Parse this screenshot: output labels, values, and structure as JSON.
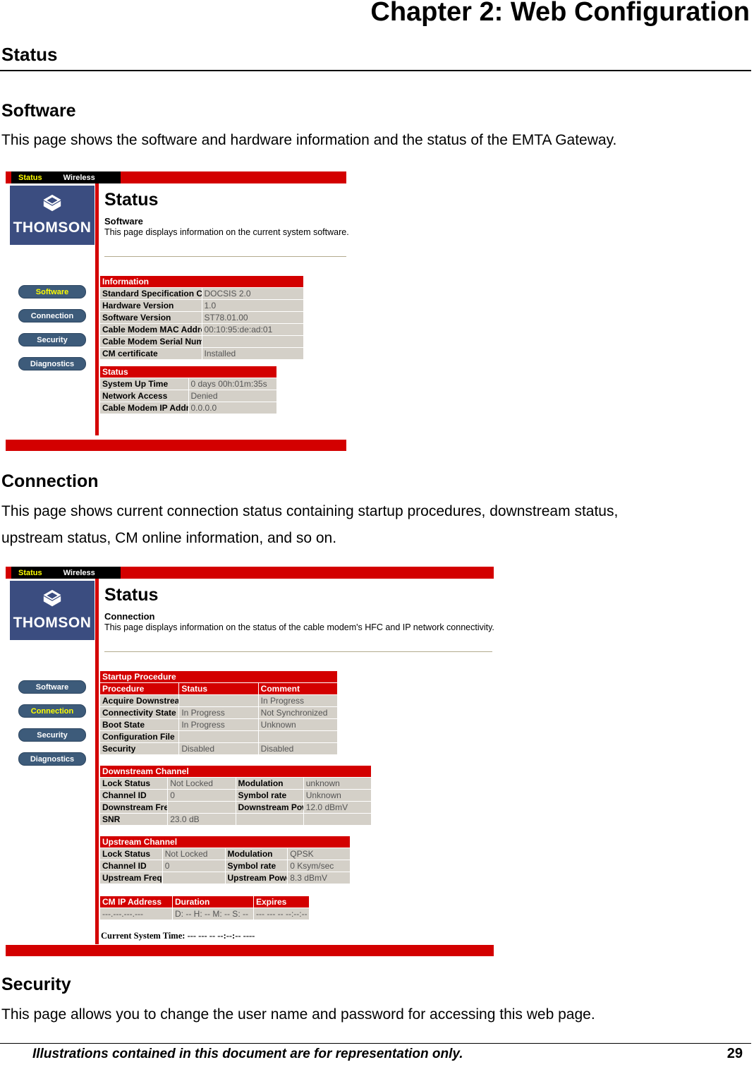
{
  "document": {
    "chapter_title": "Chapter  2: Web Configuration",
    "section_heading": "Status",
    "page_number": "29",
    "footer_note": "Illustrations contained in this document are for representation only.",
    "blocks": {
      "software_heading": "Software",
      "software_para": "This page shows the software and hardware information and the status of the EMTA Gateway.",
      "connection_heading": "Connection",
      "connection_para_line1": "This page shows current connection status containing startup procedures, downstream status,",
      "connection_para_line2": "upstream status, CM online information, and so on.",
      "security_heading": "Security",
      "security_para": "This page allows you to change the user name and password for accessing this web page."
    }
  },
  "colors": {
    "brand_red": "#d30000",
    "logo_blue": "#3b4d80",
    "button_blue": "#3d5b7a",
    "active_yellow": "#ffff00",
    "table_grey": "#d4d0c8"
  },
  "screenshot_software": {
    "topnav": {
      "status": "Status",
      "wireless": "Wireless"
    },
    "logo": {
      "brand": "THOMSON",
      "mark": "thomson-cube-logo"
    },
    "sidebar": [
      {
        "label": "Software",
        "active": true
      },
      {
        "label": "Connection",
        "active": false
      },
      {
        "label": "Security",
        "active": false
      },
      {
        "label": "Diagnostics",
        "active": false
      }
    ],
    "header": {
      "title": "Status",
      "subtitle": "Software",
      "description": "This page displays information on the current system software."
    },
    "information_table": {
      "section": "Information",
      "rows": [
        {
          "label": "Standard Specification Compliant",
          "value": "DOCSIS 2.0"
        },
        {
          "label": "Hardware Version",
          "value": "1.0"
        },
        {
          "label": "Software Version",
          "value": "ST78.01.00"
        },
        {
          "label": "Cable Modem MAC Address",
          "value": "00:10:95:de:ad:01"
        },
        {
          "label": "Cable Modem Serial Number",
          "value": ""
        },
        {
          "label": "CM certificate",
          "value": "Installed"
        }
      ]
    },
    "status_table": {
      "section": "Status",
      "rows": [
        {
          "label": "System Up Time",
          "value": "0 days 00h:01m:35s"
        },
        {
          "label": "Network Access",
          "value": "Denied"
        },
        {
          "label": "Cable Modem IP Address",
          "value": "0.0.0.0"
        }
      ]
    }
  },
  "screenshot_connection": {
    "topnav": {
      "status": "Status",
      "wireless": "Wireless"
    },
    "logo": {
      "brand": "THOMSON",
      "mark": "thomson-cube-logo"
    },
    "sidebar": [
      {
        "label": "Software",
        "active": false
      },
      {
        "label": "Connection",
        "active": true
      },
      {
        "label": "Security",
        "active": false
      },
      {
        "label": "Diagnostics",
        "active": false
      }
    ],
    "header": {
      "title": "Status",
      "subtitle": "Connection",
      "description": "This page displays information on the status of the cable modem's HFC and IP network connectivity."
    },
    "startup_table": {
      "section": "Startup Procedure",
      "columns": [
        "Procedure",
        "Status",
        "Comment"
      ],
      "rows": [
        {
          "procedure": "Acquire Downstream Channel",
          "status": "",
          "comment": "In Progress"
        },
        {
          "procedure": "Connectivity State",
          "status": "In Progress",
          "comment": "Not Synchronized"
        },
        {
          "procedure": "Boot State",
          "status": "In Progress",
          "comment": "Unknown"
        },
        {
          "procedure": "Configuration File",
          "status": "",
          "comment": ""
        },
        {
          "procedure": "Security",
          "status": "Disabled",
          "comment": "Disabled"
        }
      ]
    },
    "downstream_table": {
      "section": "Downstream Channel",
      "rows": [
        {
          "label1": "Lock Status",
          "value1": "Not Locked",
          "label2": "Modulation",
          "value2": "unknown"
        },
        {
          "label1": "Channel ID",
          "value1": "0",
          "label2": "Symbol rate",
          "value2": "Unknown"
        },
        {
          "label1": "Downstream Frequency",
          "value1": "",
          "label2": "Downstream Power",
          "value2": "12.0 dBmV"
        },
        {
          "label1": "SNR",
          "value1": "23.0 dB",
          "label2": "",
          "value2": ""
        }
      ]
    },
    "upstream_table": {
      "section": "Upstream Channel",
      "rows": [
        {
          "label1": "Lock Status",
          "value1": "Not Locked",
          "label2": "Modulation",
          "value2": "QPSK"
        },
        {
          "label1": "Channel ID",
          "value1": "0",
          "label2": "Symbol rate",
          "value2": "0 Ksym/sec"
        },
        {
          "label1": "Upstream Frequency",
          "value1": "",
          "label2": "Upstream Power",
          "value2": "8.3 dBmV"
        }
      ]
    },
    "cmip_table": {
      "columns": [
        "CM IP Address",
        "Duration",
        "Expires"
      ],
      "row": {
        "cm_ip_address": "---.---.---.---",
        "duration": "D: -- H: -- M: -- S: --",
        "expires": "--- --- -- --:--:-- ----"
      }
    },
    "system_time": {
      "label": "Current System Time:",
      "value": "--- --- -- --:--:-- ----"
    }
  }
}
